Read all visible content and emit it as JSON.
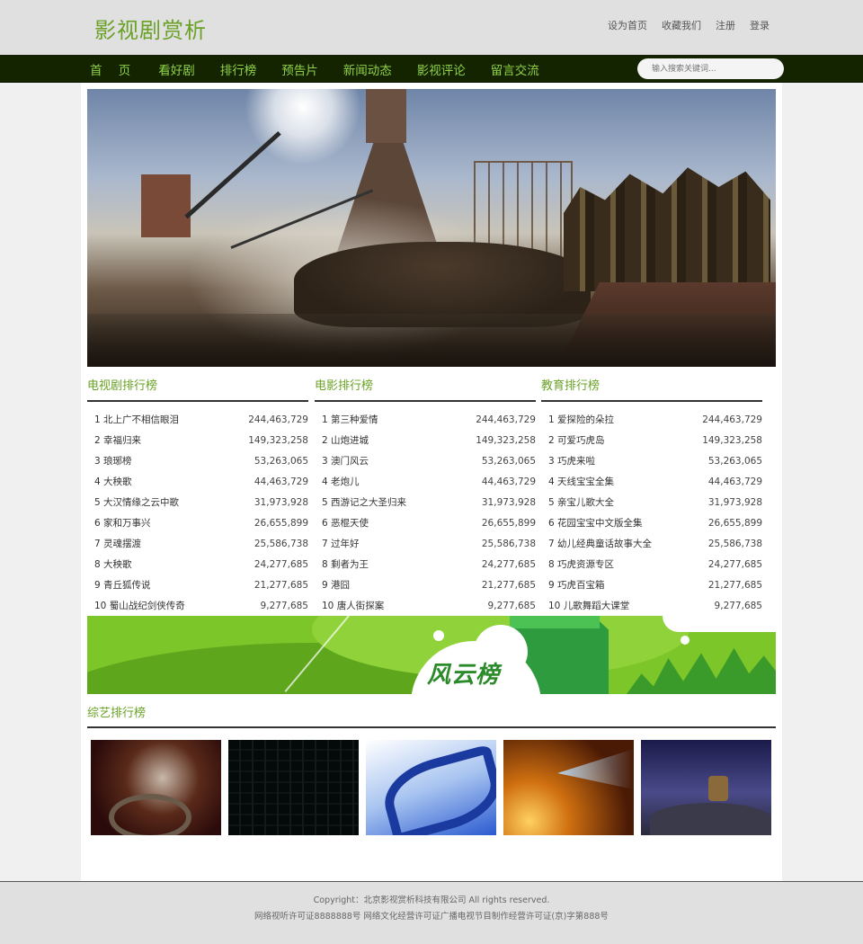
{
  "header": {
    "logo": "影视剧赏析",
    "links": [
      "设为首页",
      "收藏我们",
      "注册",
      "登录"
    ]
  },
  "nav": {
    "items": [
      "首 页",
      "看好剧",
      "排行榜",
      "预告片",
      "新闻动态",
      "影视评论",
      "留言交流"
    ],
    "search_placeholder": "输入搜索关键词..."
  },
  "rankings": [
    {
      "title": "电视剧排行榜",
      "items": [
        {
          "name": "1 北上广不相信眼泪",
          "value": "244,463,729"
        },
        {
          "name": "2 幸福归来",
          "value": "149,323,258"
        },
        {
          "name": "3 琅琊榜",
          "value": "53,263,065"
        },
        {
          "name": "4 大秧歌",
          "value": "44,463,729"
        },
        {
          "name": "5 大汉情缘之云中歌",
          "value": "31,973,928"
        },
        {
          "name": "6 家和万事兴",
          "value": "26,655,899"
        },
        {
          "name": "7 灵魂摆渡",
          "value": "25,586,738"
        },
        {
          "name": "8 大秧歌",
          "value": "24,277,685"
        },
        {
          "name": "9 青丘狐传说",
          "value": "21,277,685"
        },
        {
          "name": "10 蜀山战纪剑侠传奇",
          "value": "9,277,685"
        }
      ]
    },
    {
      "title": "电影排行榜",
      "items": [
        {
          "name": "1 第三种爱情",
          "value": "244,463,729"
        },
        {
          "name": "2 山炮进城",
          "value": "149,323,258"
        },
        {
          "name": "3 澳门风云",
          "value": "53,263,065"
        },
        {
          "name": "4 老炮儿",
          "value": "44,463,729"
        },
        {
          "name": "5 西游记之大圣归来",
          "value": "31,973,928"
        },
        {
          "name": "6 恶棍天使",
          "value": "26,655,899"
        },
        {
          "name": "7 过年好",
          "value": "25,586,738"
        },
        {
          "name": "8 剩者为王",
          "value": "24,277,685"
        },
        {
          "name": "9 港囧",
          "value": "21,277,685"
        },
        {
          "name": "10 唐人街探案",
          "value": "9,277,685"
        }
      ]
    },
    {
      "title": "教育排行榜",
      "items": [
        {
          "name": "1 爱探险的朵拉",
          "value": "244,463,729"
        },
        {
          "name": "2 可爱巧虎岛",
          "value": "149,323,258"
        },
        {
          "name": "3 巧虎来啦",
          "value": "53,263,065"
        },
        {
          "name": "4 天线宝宝全集",
          "value": "44,463,729"
        },
        {
          "name": "5 亲宝儿歌大全",
          "value": "31,973,928"
        },
        {
          "name": "6 花园宝宝中文版全集",
          "value": "26,655,899"
        },
        {
          "name": "7 幼儿经典童话故事大全",
          "value": "25,586,738"
        },
        {
          "name": "8 巧虎资源专区",
          "value": "24,277,685"
        },
        {
          "name": "9 巧虎百宝箱",
          "value": "21,277,685"
        },
        {
          "name": "10 儿歌舞蹈大课堂",
          "value": "9,277,685"
        }
      ]
    }
  ],
  "wind_banner": {
    "logo": "风云榜"
  },
  "variety": {
    "title": "综艺排行榜"
  },
  "footer": {
    "copyright": "Copyright：北京影视赏析科技有限公司 All rights reserved.",
    "license": "网络视听许可证8888888号 网络文化经营许可证广播电视节目制作经营许可证(京)字第888号"
  }
}
